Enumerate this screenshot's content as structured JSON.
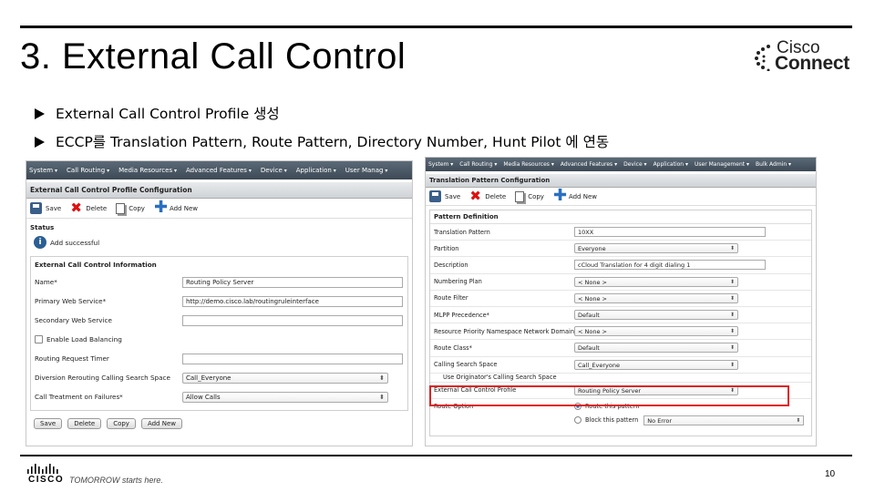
{
  "slide": {
    "title": "3. External Call Control",
    "bullets": [
      "External Call Control Profile 생성",
      "ECCP를 Translation Pattern, Route Pattern, Directory Number, Hunt Pilot 에 연동"
    ],
    "logo": {
      "line1": "Cisco",
      "line2": "Connect"
    },
    "footer": {
      "brand": "CISCO",
      "tagline": "TOMORROW starts here.",
      "page_number": "10"
    }
  },
  "left_screen": {
    "menu": [
      "System",
      "Call Routing",
      "Media Resources",
      "Advanced Features",
      "Device",
      "Application",
      "User Manag"
    ],
    "page_title": "External Call Control Profile Configuration",
    "toolbar": {
      "save": "Save",
      "delete": "Delete",
      "copy": "Copy",
      "add_new": "Add New"
    },
    "status_label": "Status",
    "status_message": "Add successful",
    "section_title": "External Call Control Information",
    "fields": {
      "name_label": "Name*",
      "name_value": "Routing Policy Server",
      "primary_label": "Primary Web Service*",
      "primary_value": "http://demo.cisco.lab/routingruleinterface",
      "secondary_label": "Secondary Web Service",
      "secondary_value": "",
      "load_balancing_label": "Enable Load Balancing",
      "timer_label": "Routing Request Timer",
      "timer_value": "",
      "diversion_label": "Diversion Rerouting Calling Search Space",
      "diversion_value": "Call_Everyone",
      "failure_label": "Call Treatment on Failures*",
      "failure_value": "Allow Calls"
    },
    "bottom_buttons": {
      "save": "Save",
      "delete": "Delete",
      "copy": "Copy",
      "add_new": "Add New"
    }
  },
  "right_screen": {
    "menu": [
      "System",
      "Call Routing",
      "Media Resources",
      "Advanced Features",
      "Device",
      "Application",
      "User Management",
      "Bulk Admin"
    ],
    "page_title": "Translation Pattern Configuration",
    "toolbar": {
      "save": "Save",
      "delete": "Delete",
      "copy": "Copy",
      "add_new": "Add New"
    },
    "section_title": "Pattern Definition",
    "rows": {
      "translation_pattern_label": "Translation Pattern",
      "translation_pattern_value": "10XX",
      "partition_label": "Partition",
      "partition_value": "Everyone",
      "description_label": "Description",
      "description_value": "cCloud Translation for 4 digit dialing 1",
      "numbering_plan_label": "Numbering Plan",
      "numbering_plan_value": "< None >",
      "route_filter_label": "Route Filter",
      "route_filter_value": "< None >",
      "mlpp_label": "MLPP Precedence*",
      "mlpp_value": "Default",
      "resource_priority_label": "Resource Priority Namespace Network Domain",
      "resource_priority_value": "< None >",
      "route_class_label": "Route Class*",
      "route_class_value": "Default",
      "css_label": "Calling Search Space",
      "css_value": "Call_Everyone",
      "originator_label": "Use Originator's Calling Search Space",
      "eccp_label": "External Call Control Profile",
      "eccp_value": "Routing Policy Server",
      "route_option_label": "Route Option",
      "route_this_pattern": "Route this pattern",
      "block_this_pattern": "Block this pattern",
      "block_reason": "No Error"
    }
  },
  "colors": {
    "highlight": "#e02020",
    "menubar": "#4a5866"
  }
}
